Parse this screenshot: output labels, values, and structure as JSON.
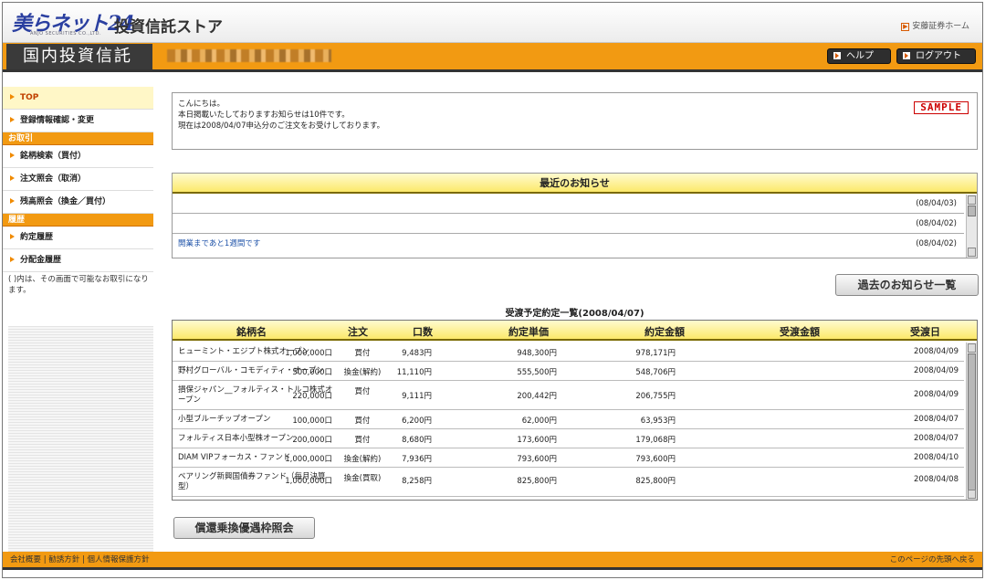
{
  "header": {
    "logo_text": "美らネット24",
    "logo_sub": "ANJO SECURITIES CO.,LTD.",
    "store_title": "投資信託ストア",
    "home_link": "安藤証券ホーム"
  },
  "nav": {
    "section_title": "国内投資信託",
    "help_label": "ヘルプ",
    "logout_label": "ログアウト"
  },
  "sidebar": {
    "items": [
      {
        "label": "TOP"
      },
      {
        "label": "登録情報確認・変更"
      }
    ],
    "cat_trade": "お取引",
    "trade_items": [
      {
        "label": "銘柄検索（買付）"
      },
      {
        "label": "注文照会（取消）"
      },
      {
        "label": "残高照会（換金／買付）"
      }
    ],
    "cat_history": "履歴",
    "history_items": [
      {
        "label": "約定履歴"
      },
      {
        "label": "分配金履歴"
      }
    ],
    "note": "( )内は、その画面で可能なお取引になります。"
  },
  "welcome": {
    "line1": "こんにちは。",
    "line2": "本日掲載いたしておりますお知らせは10件です。",
    "line3": "現在は2008/04/07申込分のご注文をお受けしております。",
    "sample": "SAMPLE"
  },
  "news": {
    "title": "最近のお知らせ",
    "rows": [
      {
        "text": "",
        "date": "(08/04/03)"
      },
      {
        "text": "",
        "date": "(08/04/02)"
      },
      {
        "text": "開業まであと1週間です",
        "date": "(08/04/02)"
      }
    ]
  },
  "past_news_button": "過去のお知らせ一覧",
  "table": {
    "title": "受渡予定約定一覧(2008/04/07)",
    "headers": {
      "name": "銘柄名",
      "order": "注文",
      "qty": "口数",
      "price": "約定単価",
      "amount": "約定金額",
      "transfer_amount": "受渡金額",
      "transfer_date": "受渡日"
    },
    "rows": [
      {
        "name": "ヒューミント・エジプト株式オープン",
        "order": "買付",
        "qty": "1,000,000口",
        "price": "9,483円",
        "amount": "948,300円",
        "tamt": "978,171円",
        "tdate": "2008/04/09"
      },
      {
        "name": "野村グローバル・コモディティ・オープン",
        "order": "換金(解約)",
        "qty": "500,000口",
        "price": "11,110円",
        "amount": "555,500円",
        "tamt": "548,706円",
        "tdate": "2008/04/09"
      },
      {
        "name": "損保ジャパン__フォルティス・トルコ株式オープン",
        "order": "買付",
        "qty": "220,000口",
        "price": "9,111円",
        "amount": "200,442円",
        "tamt": "206,755円",
        "tdate": "2008/04/09"
      },
      {
        "name": "小型ブルーチップオープン",
        "order": "買付",
        "qty": "100,000口",
        "price": "6,200円",
        "amount": "62,000円",
        "tamt": "63,953円",
        "tdate": "2008/04/07"
      },
      {
        "name": "フォルティス日本小型株オープン",
        "order": "買付",
        "qty": "200,000口",
        "price": "8,680円",
        "amount": "173,600円",
        "tamt": "179,068円",
        "tdate": "2008/04/07"
      },
      {
        "name": "DIAM VIPフォーカス・ファンド",
        "order": "換金(解約)",
        "qty": "1,000,000口",
        "price": "7,936円",
        "amount": "793,600円",
        "tamt": "793,600円",
        "tdate": "2008/04/10"
      },
      {
        "name": "ベアリング新興国債券ファンド（毎月決算型）",
        "order": "換金(買取)",
        "qty": "1,000,000口",
        "price": "8,258円",
        "amount": "825,800円",
        "tamt": "825,800円",
        "tdate": "2008/04/08"
      }
    ]
  },
  "redemption_button": "償還乗換優遇枠照会",
  "footer": {
    "left": "会社概要 | 勧誘方針 | 個人情報保護方針",
    "right": "このページの先頭へ戻る"
  }
}
